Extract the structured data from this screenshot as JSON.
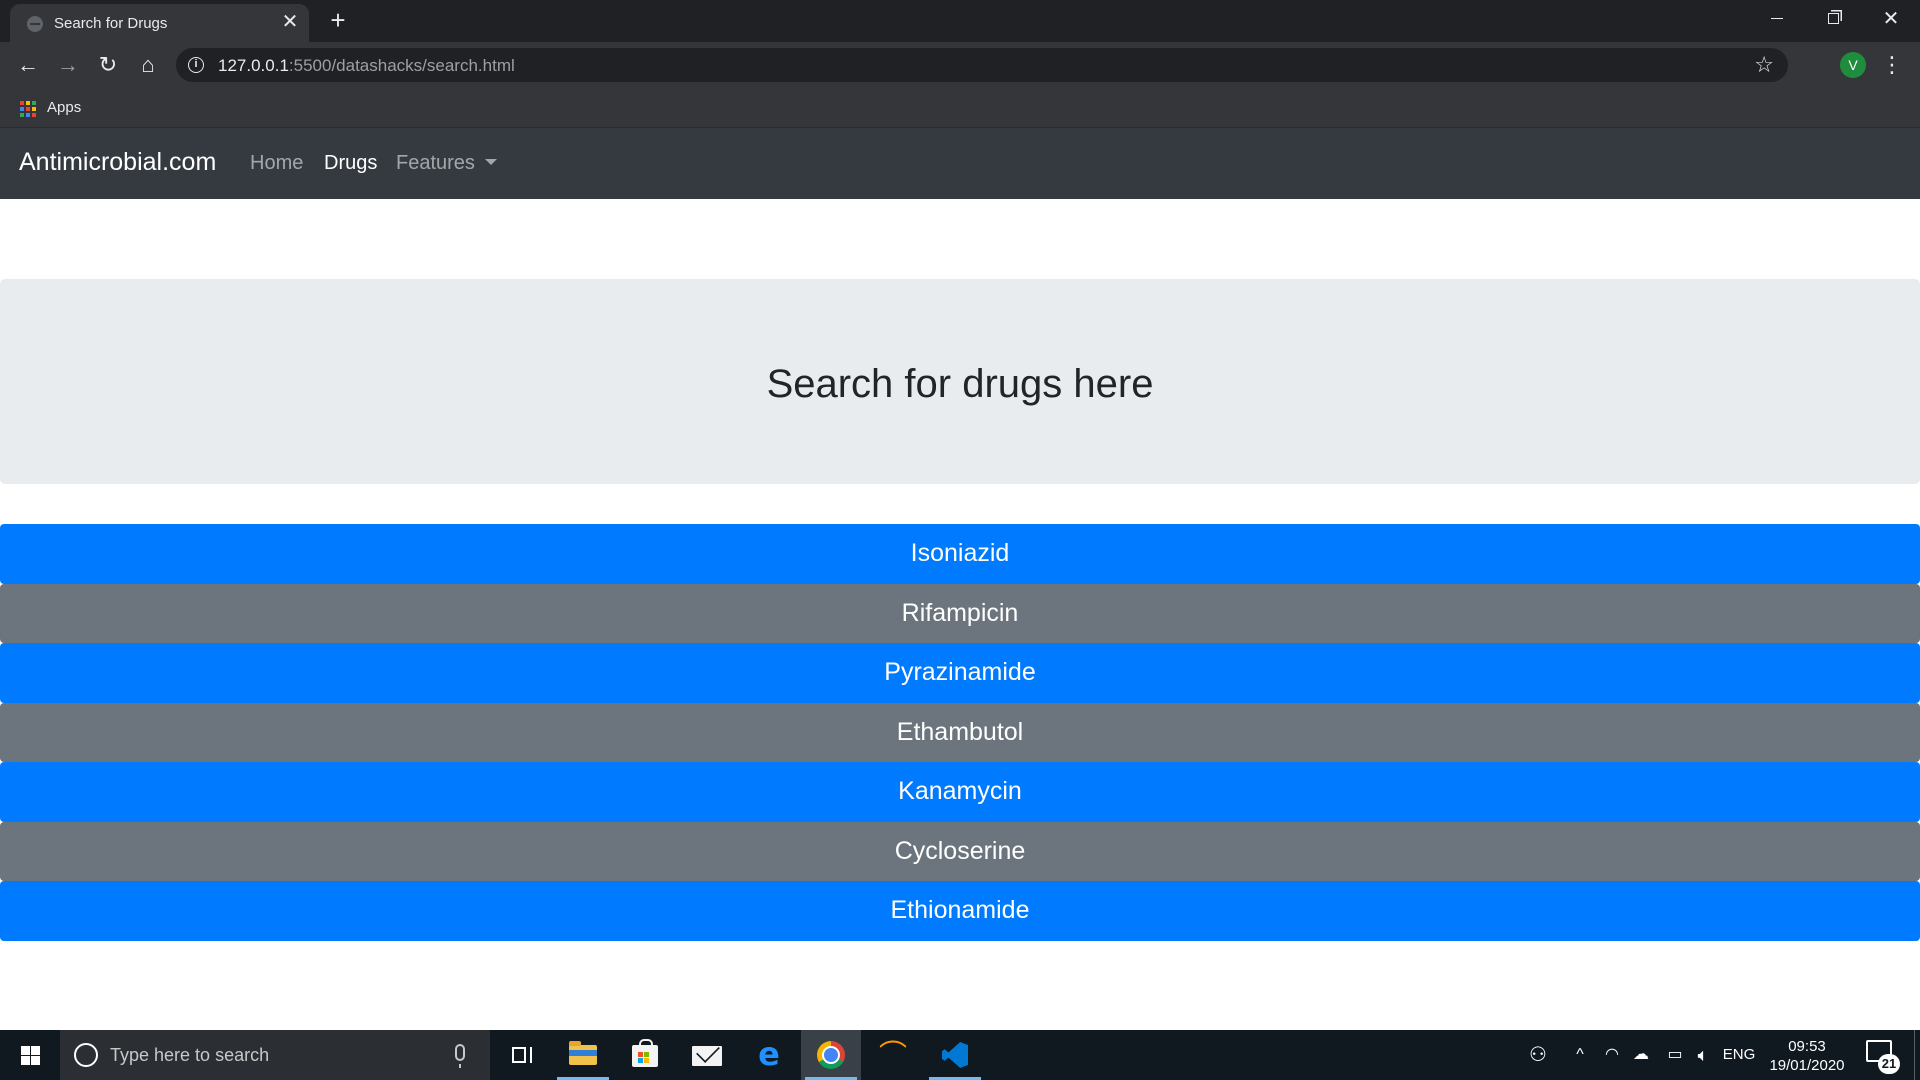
{
  "browser": {
    "tab_title": "Search for Drugs",
    "tab_close_glyph": "✕",
    "new_tab_glyph": "+",
    "url_host": "127.0.0.1",
    "url_rest": ":5500/datashacks/search.html",
    "avatar_initial": "V",
    "bookmarks": {
      "apps_label": "Apps"
    },
    "icons": [
      "back-arrow-icon",
      "forward-arrow-icon",
      "reload-icon",
      "home-icon",
      "info-icon",
      "star-icon",
      "kebab-menu-icon"
    ]
  },
  "navbar": {
    "brand": "Antimicrobial.com",
    "links": [
      {
        "label": "Home",
        "active": false
      },
      {
        "label": "Drugs",
        "active": true
      },
      {
        "label": "Features",
        "active": false,
        "dropdown": true
      }
    ]
  },
  "jumbotron": {
    "title": "Search for drugs here"
  },
  "drugs": [
    {
      "name": "Isoniazid",
      "style": "primary"
    },
    {
      "name": "Rifampicin",
      "style": "secondary"
    },
    {
      "name": "Pyrazinamide",
      "style": "primary"
    },
    {
      "name": "Ethambutol",
      "style": "secondary"
    },
    {
      "name": "Kanamycin",
      "style": "primary"
    },
    {
      "name": "Cycloserine",
      "style": "secondary"
    },
    {
      "name": "Ethionamide",
      "style": "primary"
    }
  ],
  "colors": {
    "primary": "#007bff",
    "secondary": "#6c757d",
    "navbar": "#343a40",
    "jumbotron": "#e9ecef"
  },
  "taskbar": {
    "search_placeholder": "Type here to search",
    "apps": [
      "task-view-icon",
      "file-explorer-icon",
      "microsoft-store-icon",
      "mail-icon",
      "edge-icon",
      "chrome-icon",
      "sublime-text-icon",
      "vscode-icon"
    ],
    "language": "ENG",
    "time": "09:53",
    "date": "19/01/2020",
    "notification_count": "21"
  }
}
